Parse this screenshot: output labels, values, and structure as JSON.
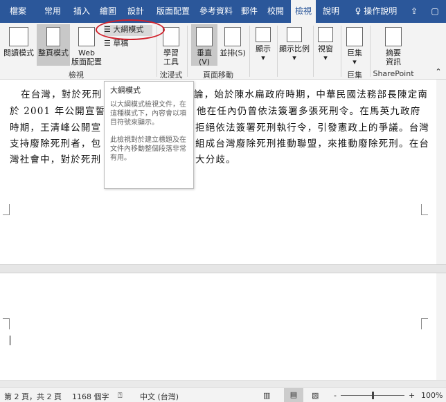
{
  "tabs": [
    "檔案",
    "常用",
    "插入",
    "繪圖",
    "設計",
    "版面配置",
    "參考資料",
    "郵件",
    "校閱",
    "檢視",
    "說明",
    "操作說明"
  ],
  "active_tab": "檢視",
  "ribbon": {
    "read_mode": "閱讀模式",
    "print_layout": "整頁模式",
    "web_layout_1": "Web",
    "web_layout_2": "版面配置",
    "outline": "大綱模式",
    "draft": "草稿",
    "learning_1": "學習",
    "learning_2": "工具",
    "vertical": "垂直(V)",
    "side_by_side": "並排(S)",
    "show": "顯示",
    "zoom": "顯示比例",
    "window": "視窗",
    "macros": "巨集",
    "summary_1": "摘要",
    "summary_2": "資訊",
    "groups": {
      "views": "檢視",
      "immersive": "沈浸式",
      "page_movement": "頁面移動",
      "macros": "巨集",
      "sharepoint": "SharePoint"
    }
  },
  "document": {
    "lines": [
      {
        "left": "在台灣，對於死刑",
        "right": "論，始於陳水扁政府時期，中華民國法務部長陳定南"
      },
      {
        "left": "於 2001 年公開宣誓要",
        "right": "他在任內仍曾依法簽署多張死刑令。在馬英九政府"
      },
      {
        "left": "時期，王清峰公開宣",
        "right": "拒絕依法簽署死刑執行令，引發憲政上的爭議。台灣"
      },
      {
        "left": "支持廢除死刑者，包",
        "right": "組成台灣廢除死刑推動聯盟，來推動廢除死刑。在台"
      },
      {
        "left": "灣社會中，對於死刑",
        "right": "大分歧。"
      }
    ]
  },
  "tooltip": {
    "title": "大綱模式",
    "body1": "以大綱模式檢視文件，在這種模式下，內容會以項目符號來顯示。",
    "body2": "此檢視對於建立標題及在文件內移動整個段落非常有用。"
  },
  "status": {
    "page": "第 2 頁，共 2 頁",
    "words": "1168 個字",
    "language": "中文 (台灣)",
    "zoom": "100%",
    "zoom_value": 100
  }
}
